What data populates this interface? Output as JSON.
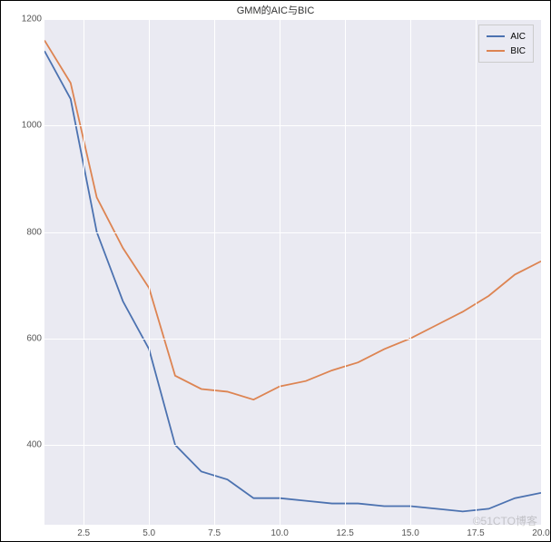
{
  "chart_data": {
    "type": "line",
    "title": "GMM的AIC与BIC",
    "xlabel": "",
    "ylabel": "",
    "xlim": [
      1,
      20
    ],
    "ylim": [
      250,
      1200
    ],
    "x_ticks": [
      2.5,
      5.0,
      7.5,
      10.0,
      12.5,
      15.0,
      17.5,
      20.0
    ],
    "y_ticks": [
      400,
      600,
      800,
      1000,
      1200
    ],
    "x": [
      1,
      2,
      3,
      4,
      5,
      6,
      7,
      8,
      9,
      10,
      11,
      12,
      13,
      14,
      15,
      16,
      17,
      18,
      19,
      20
    ],
    "series": [
      {
        "name": "AIC",
        "color": "#4c72b0",
        "values": [
          1140,
          1050,
          800,
          670,
          580,
          400,
          350,
          335,
          300,
          300,
          295,
          290,
          290,
          285,
          285,
          280,
          275,
          280,
          300,
          310
        ]
      },
      {
        "name": "BIC",
        "color": "#dd8452",
        "values": [
          1160,
          1080,
          865,
          770,
          695,
          530,
          505,
          500,
          485,
          510,
          520,
          540,
          555,
          580,
          600,
          625,
          650,
          680,
          720,
          745
        ]
      }
    ],
    "legend": {
      "position": "upper right"
    }
  },
  "watermark": "©51CTO博客"
}
